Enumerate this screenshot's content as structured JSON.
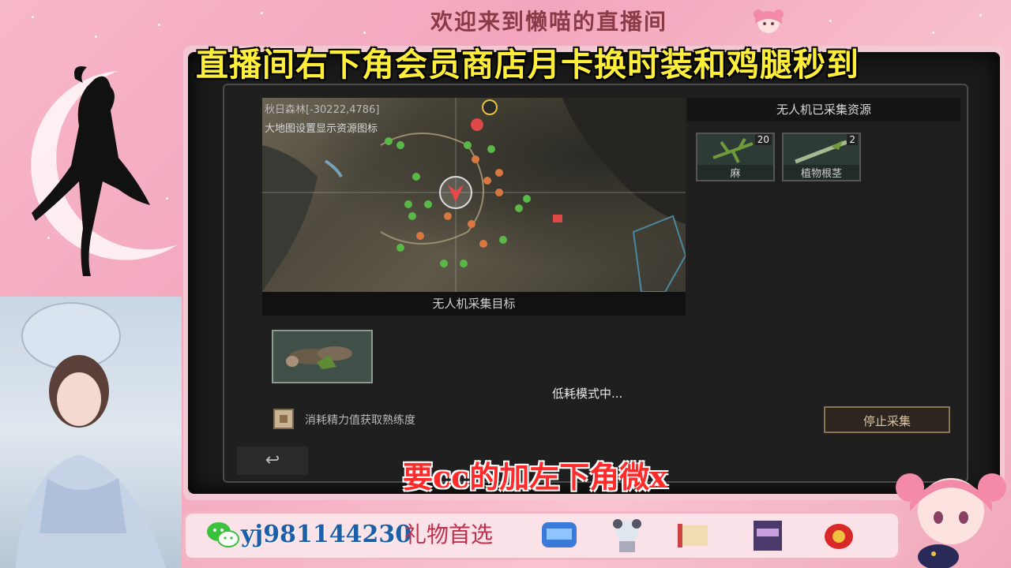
{
  "overlay": {
    "welcome": "欢迎来到懒喵的直播间",
    "banner": "直播间右下角会员商店月卡换时装和鸡腿秒到",
    "cc_text": "要cc的加左下角微x",
    "wechat_id": "yj981144230",
    "gift_label": "礼物首选"
  },
  "game": {
    "panel_title": "",
    "map": {
      "coords": "秋日森林[-30222,4786]",
      "hint": "大地图设置显示资源图标"
    },
    "target_header": "无人机采集目标",
    "status": "低耗模式中...",
    "checkbox_label": "消耗精力值获取熟练度",
    "stop_button": "停止采集",
    "collected_header": "无人机已采集资源",
    "resources": [
      {
        "name": "麻",
        "count": "20"
      },
      {
        "name": "植物根茎",
        "count": "2"
      }
    ],
    "back_icon": "↩"
  },
  "colors": {
    "banner": "#ffef3a",
    "cc_text": "#ff2a2a",
    "wechat_id": "#1b5fa8",
    "background": "#f3a6bd"
  }
}
